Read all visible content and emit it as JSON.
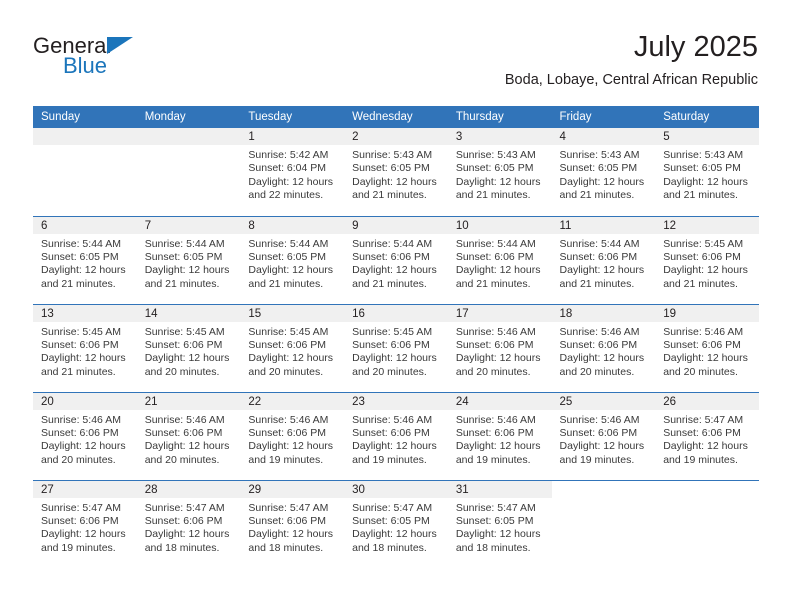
{
  "brand": {
    "name_top": "General",
    "name_bottom": "Blue",
    "triangle_icon": "triangle-icon",
    "color_dark": "#231f20",
    "color_blue": "#1b75bb"
  },
  "header": {
    "title": "July 2025",
    "subtitle": "Boda, Lobaye, Central African Republic"
  },
  "theme": {
    "header_blue": "#3174b9",
    "daynum_band": "#f0f0f0",
    "text": "#3a3a3a"
  },
  "weekday_headers": [
    "Sunday",
    "Monday",
    "Tuesday",
    "Wednesday",
    "Thursday",
    "Friday",
    "Saturday"
  ],
  "weeks": [
    {
      "days": [
        {
          "num": "",
          "sunrise": "",
          "sunset": "",
          "daylight_1": "",
          "daylight_2": "",
          "empty": true
        },
        {
          "num": "",
          "sunrise": "",
          "sunset": "",
          "daylight_1": "",
          "daylight_2": "",
          "empty": true
        },
        {
          "num": "1",
          "sunrise": "Sunrise: 5:42 AM",
          "sunset": "Sunset: 6:04 PM",
          "daylight_1": "Daylight: 12 hours",
          "daylight_2": "and 22 minutes."
        },
        {
          "num": "2",
          "sunrise": "Sunrise: 5:43 AM",
          "sunset": "Sunset: 6:05 PM",
          "daylight_1": "Daylight: 12 hours",
          "daylight_2": "and 21 minutes."
        },
        {
          "num": "3",
          "sunrise": "Sunrise: 5:43 AM",
          "sunset": "Sunset: 6:05 PM",
          "daylight_1": "Daylight: 12 hours",
          "daylight_2": "and 21 minutes."
        },
        {
          "num": "4",
          "sunrise": "Sunrise: 5:43 AM",
          "sunset": "Sunset: 6:05 PM",
          "daylight_1": "Daylight: 12 hours",
          "daylight_2": "and 21 minutes."
        },
        {
          "num": "5",
          "sunrise": "Sunrise: 5:43 AM",
          "sunset": "Sunset: 6:05 PM",
          "daylight_1": "Daylight: 12 hours",
          "daylight_2": "and 21 minutes."
        }
      ]
    },
    {
      "days": [
        {
          "num": "6",
          "sunrise": "Sunrise: 5:44 AM",
          "sunset": "Sunset: 6:05 PM",
          "daylight_1": "Daylight: 12 hours",
          "daylight_2": "and 21 minutes."
        },
        {
          "num": "7",
          "sunrise": "Sunrise: 5:44 AM",
          "sunset": "Sunset: 6:05 PM",
          "daylight_1": "Daylight: 12 hours",
          "daylight_2": "and 21 minutes."
        },
        {
          "num": "8",
          "sunrise": "Sunrise: 5:44 AM",
          "sunset": "Sunset: 6:05 PM",
          "daylight_1": "Daylight: 12 hours",
          "daylight_2": "and 21 minutes."
        },
        {
          "num": "9",
          "sunrise": "Sunrise: 5:44 AM",
          "sunset": "Sunset: 6:06 PM",
          "daylight_1": "Daylight: 12 hours",
          "daylight_2": "and 21 minutes."
        },
        {
          "num": "10",
          "sunrise": "Sunrise: 5:44 AM",
          "sunset": "Sunset: 6:06 PM",
          "daylight_1": "Daylight: 12 hours",
          "daylight_2": "and 21 minutes."
        },
        {
          "num": "11",
          "sunrise": "Sunrise: 5:44 AM",
          "sunset": "Sunset: 6:06 PM",
          "daylight_1": "Daylight: 12 hours",
          "daylight_2": "and 21 minutes."
        },
        {
          "num": "12",
          "sunrise": "Sunrise: 5:45 AM",
          "sunset": "Sunset: 6:06 PM",
          "daylight_1": "Daylight: 12 hours",
          "daylight_2": "and 21 minutes."
        }
      ]
    },
    {
      "days": [
        {
          "num": "13",
          "sunrise": "Sunrise: 5:45 AM",
          "sunset": "Sunset: 6:06 PM",
          "daylight_1": "Daylight: 12 hours",
          "daylight_2": "and 21 minutes."
        },
        {
          "num": "14",
          "sunrise": "Sunrise: 5:45 AM",
          "sunset": "Sunset: 6:06 PM",
          "daylight_1": "Daylight: 12 hours",
          "daylight_2": "and 20 minutes."
        },
        {
          "num": "15",
          "sunrise": "Sunrise: 5:45 AM",
          "sunset": "Sunset: 6:06 PM",
          "daylight_1": "Daylight: 12 hours",
          "daylight_2": "and 20 minutes."
        },
        {
          "num": "16",
          "sunrise": "Sunrise: 5:45 AM",
          "sunset": "Sunset: 6:06 PM",
          "daylight_1": "Daylight: 12 hours",
          "daylight_2": "and 20 minutes."
        },
        {
          "num": "17",
          "sunrise": "Sunrise: 5:46 AM",
          "sunset": "Sunset: 6:06 PM",
          "daylight_1": "Daylight: 12 hours",
          "daylight_2": "and 20 minutes."
        },
        {
          "num": "18",
          "sunrise": "Sunrise: 5:46 AM",
          "sunset": "Sunset: 6:06 PM",
          "daylight_1": "Daylight: 12 hours",
          "daylight_2": "and 20 minutes."
        },
        {
          "num": "19",
          "sunrise": "Sunrise: 5:46 AM",
          "sunset": "Sunset: 6:06 PM",
          "daylight_1": "Daylight: 12 hours",
          "daylight_2": "and 20 minutes."
        }
      ]
    },
    {
      "days": [
        {
          "num": "20",
          "sunrise": "Sunrise: 5:46 AM",
          "sunset": "Sunset: 6:06 PM",
          "daylight_1": "Daylight: 12 hours",
          "daylight_2": "and 20 minutes."
        },
        {
          "num": "21",
          "sunrise": "Sunrise: 5:46 AM",
          "sunset": "Sunset: 6:06 PM",
          "daylight_1": "Daylight: 12 hours",
          "daylight_2": "and 20 minutes."
        },
        {
          "num": "22",
          "sunrise": "Sunrise: 5:46 AM",
          "sunset": "Sunset: 6:06 PM",
          "daylight_1": "Daylight: 12 hours",
          "daylight_2": "and 19 minutes."
        },
        {
          "num": "23",
          "sunrise": "Sunrise: 5:46 AM",
          "sunset": "Sunset: 6:06 PM",
          "daylight_1": "Daylight: 12 hours",
          "daylight_2": "and 19 minutes."
        },
        {
          "num": "24",
          "sunrise": "Sunrise: 5:46 AM",
          "sunset": "Sunset: 6:06 PM",
          "daylight_1": "Daylight: 12 hours",
          "daylight_2": "and 19 minutes."
        },
        {
          "num": "25",
          "sunrise": "Sunrise: 5:46 AM",
          "sunset": "Sunset: 6:06 PM",
          "daylight_1": "Daylight: 12 hours",
          "daylight_2": "and 19 minutes."
        },
        {
          "num": "26",
          "sunrise": "Sunrise: 5:47 AM",
          "sunset": "Sunset: 6:06 PM",
          "daylight_1": "Daylight: 12 hours",
          "daylight_2": "and 19 minutes."
        }
      ]
    },
    {
      "days": [
        {
          "num": "27",
          "sunrise": "Sunrise: 5:47 AM",
          "sunset": "Sunset: 6:06 PM",
          "daylight_1": "Daylight: 12 hours",
          "daylight_2": "and 19 minutes."
        },
        {
          "num": "28",
          "sunrise": "Sunrise: 5:47 AM",
          "sunset": "Sunset: 6:06 PM",
          "daylight_1": "Daylight: 12 hours",
          "daylight_2": "and 18 minutes."
        },
        {
          "num": "29",
          "sunrise": "Sunrise: 5:47 AM",
          "sunset": "Sunset: 6:06 PM",
          "daylight_1": "Daylight: 12 hours",
          "daylight_2": "and 18 minutes."
        },
        {
          "num": "30",
          "sunrise": "Sunrise: 5:47 AM",
          "sunset": "Sunset: 6:05 PM",
          "daylight_1": "Daylight: 12 hours",
          "daylight_2": "and 18 minutes."
        },
        {
          "num": "31",
          "sunrise": "Sunrise: 5:47 AM",
          "sunset": "Sunset: 6:05 PM",
          "daylight_1": "Daylight: 12 hours",
          "daylight_2": "and 18 minutes."
        },
        {
          "num": "",
          "sunrise": "",
          "sunset": "",
          "daylight_1": "",
          "daylight_2": "",
          "empty": true,
          "nofill": true
        },
        {
          "num": "",
          "sunrise": "",
          "sunset": "",
          "daylight_1": "",
          "daylight_2": "",
          "empty": true,
          "nofill": true
        }
      ]
    }
  ]
}
